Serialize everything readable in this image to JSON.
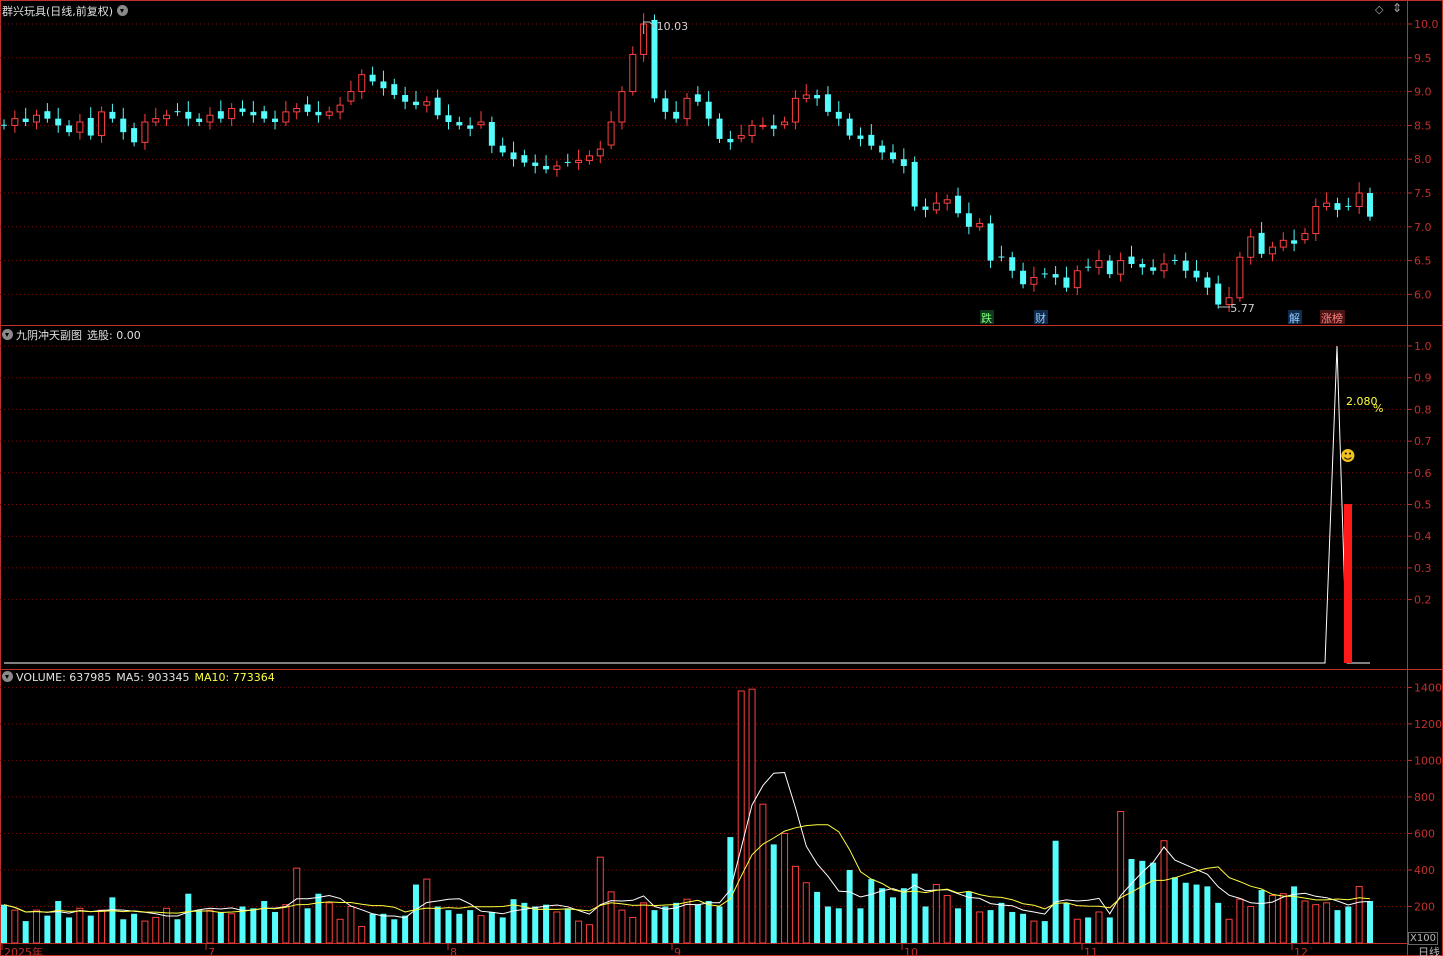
{
  "price_panel": {
    "title": "群兴玩具",
    "mode": "(日线,前复权)",
    "high_label": "10.03",
    "low_label": "5.77",
    "y_ticks": [
      "10.0",
      "9.5",
      "9.0",
      "8.5",
      "8.0",
      "7.5",
      "7.0",
      "6.5",
      "6.0"
    ],
    "tags": [
      {
        "text": "跌",
        "color": "#2ea44f"
      },
      {
        "text": "财",
        "color": "#2f7bd6"
      },
      {
        "text": "解",
        "color": "#2f7bd6"
      },
      {
        "text": "涨榜",
        "color": "#d23a3a"
      }
    ]
  },
  "indicator_panel": {
    "name": "九阴冲天副图",
    "field_label": "选股:",
    "field_value": "0.00",
    "annot_value": "2.080",
    "annot_unit": "%",
    "smiley": "☻",
    "y_ticks": [
      "1.0",
      "0.9",
      "0.8",
      "0.7",
      "0.6",
      "0.5",
      "0.4",
      "0.3",
      "0.2"
    ]
  },
  "volume_panel": {
    "label": "VOLUME:",
    "value": "637985",
    "ma5_label": "MA5:",
    "ma5_value": "903345",
    "ma10_label": "MA10:",
    "ma10_value": "773364",
    "unit": "X100",
    "y_ticks": [
      "1400",
      "1200",
      "1000",
      "800",
      "600",
      "400",
      "200"
    ]
  },
  "x_axis": {
    "labels": [
      "2025年",
      "7",
      "8",
      "9",
      "10",
      "11",
      "12",
      "日线"
    ]
  },
  "colors": {
    "up": "#ff4040",
    "down": "#54fcfc",
    "grid": "#7a1010",
    "axis": "#c0302a",
    "ma5": "#ffffff",
    "ma10": "#ffff40"
  }
}
